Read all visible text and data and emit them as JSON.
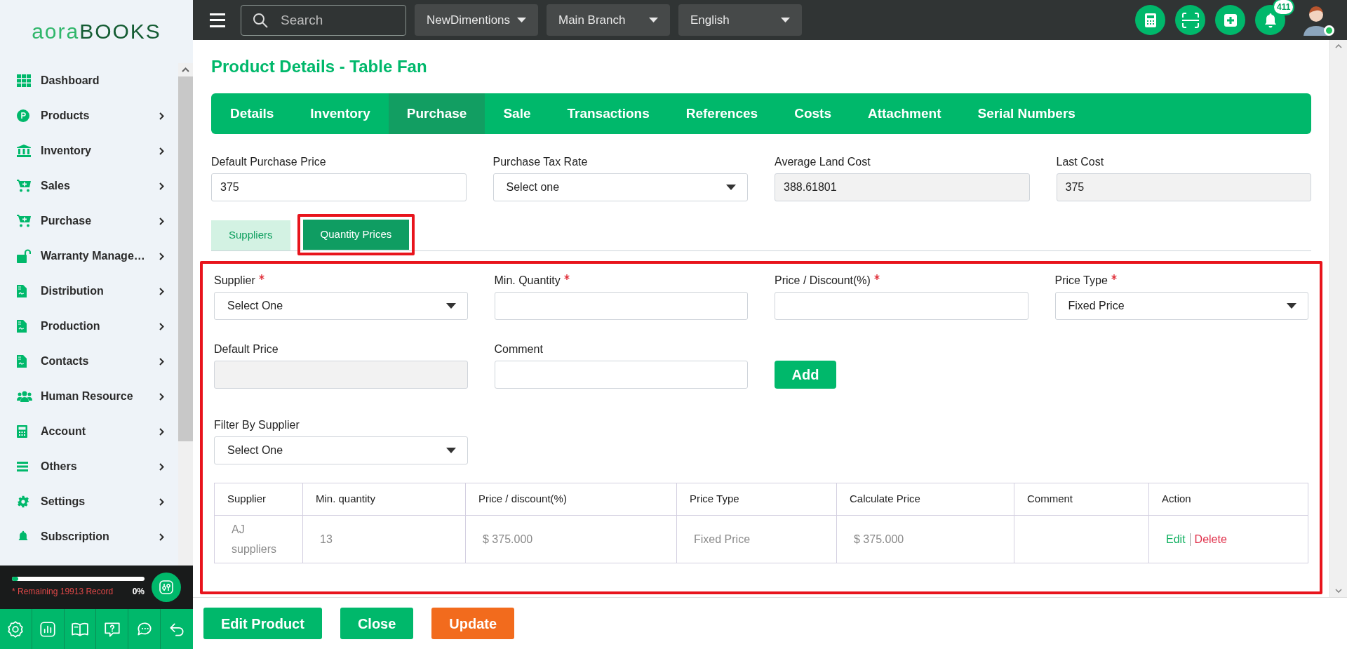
{
  "brand": {
    "logo_light": "aora",
    "logo_dark": "BOOKS"
  },
  "sidebar": {
    "items": [
      {
        "label": "Dashboard",
        "has_submenu": false
      },
      {
        "label": "Products",
        "has_submenu": true
      },
      {
        "label": "Inventory",
        "has_submenu": true
      },
      {
        "label": "Sales",
        "has_submenu": true
      },
      {
        "label": "Purchase",
        "has_submenu": true
      },
      {
        "label": "Warranty Manage…",
        "has_submenu": true
      },
      {
        "label": "Distribution",
        "has_submenu": true
      },
      {
        "label": "Production",
        "has_submenu": true
      },
      {
        "label": "Contacts",
        "has_submenu": true
      },
      {
        "label": "Human Resource",
        "has_submenu": true
      },
      {
        "label": "Account",
        "has_submenu": true
      },
      {
        "label": "Others",
        "has_submenu": true
      },
      {
        "label": "Settings",
        "has_submenu": true
      },
      {
        "label": "Subscription",
        "has_submenu": true
      }
    ],
    "usage": {
      "text": "* Remaining 19913 Record",
      "percent": "0%",
      "level": 0.05
    }
  },
  "topbar": {
    "search_placeholder": "Search",
    "dropdowns": [
      "NewDimentions",
      "Main Branch",
      "English"
    ],
    "notification_count": "411"
  },
  "page": {
    "title": "Product Details - Table Fan",
    "tabs": [
      {
        "label": "Details",
        "selected": false
      },
      {
        "label": "Inventory",
        "selected": false
      },
      {
        "label": "Purchase",
        "selected": true
      },
      {
        "label": "Sale",
        "selected": false
      },
      {
        "label": "Transactions",
        "selected": false
      },
      {
        "label": "References",
        "selected": false
      },
      {
        "label": "Costs",
        "selected": false
      },
      {
        "label": "Attachment",
        "selected": false
      },
      {
        "label": "Serial Numbers",
        "selected": false
      }
    ],
    "fields": [
      {
        "label": "Default Purchase Price",
        "kind": "input",
        "value": "375",
        "disabled": false
      },
      {
        "label": "Purchase Tax Rate",
        "kind": "select",
        "value": "Select one",
        "disabled": false
      },
      {
        "label": "Average Land Cost",
        "kind": "input",
        "value": "388.61801",
        "disabled": true
      },
      {
        "label": "Last Cost",
        "kind": "input",
        "value": "375",
        "disabled": true
      }
    ],
    "subtabs": [
      {
        "label": "Suppliers",
        "selected": false,
        "highlighted": false
      },
      {
        "label": "Quantity Prices",
        "selected": true,
        "highlighted": true
      }
    ],
    "form": {
      "highlighted": true,
      "row1": [
        {
          "label": "Supplier",
          "required": true,
          "kind": "select",
          "value": "Select One"
        },
        {
          "label": "Min. Quantity",
          "required": true,
          "kind": "input"
        },
        {
          "label": "Price / Discount(%)",
          "required": true,
          "kind": "input"
        },
        {
          "label": "Price Type",
          "required": true,
          "kind": "select",
          "value": "Fixed Price"
        }
      ],
      "row2": [
        {
          "label": "Default Price",
          "required": false,
          "kind": "input",
          "disabled": true
        },
        {
          "label": "Comment",
          "required": false,
          "kind": "input",
          "disabled": false
        }
      ],
      "add_button": "Add",
      "filter": {
        "label": "Filter By Supplier",
        "value": "Select One"
      },
      "table": {
        "columns": [
          "Supplier",
          "Min. quantity",
          "Price / discount(%)",
          "Price Type",
          "Calculate Price",
          "Comment",
          "Action"
        ],
        "rows": [
          {
            "cells": [
              "AJ suppliers",
              "13",
              "$ 375.000",
              "Fixed Price",
              "$ 375.000",
              ""
            ],
            "actions": [
              "Edit",
              "Delete"
            ]
          }
        ]
      }
    }
  },
  "footer": {
    "buttons": [
      {
        "label": "Edit Product",
        "kind": "primary"
      },
      {
        "label": "Close",
        "kind": "primary"
      },
      {
        "label": "Update",
        "kind": "warning"
      }
    ]
  }
}
